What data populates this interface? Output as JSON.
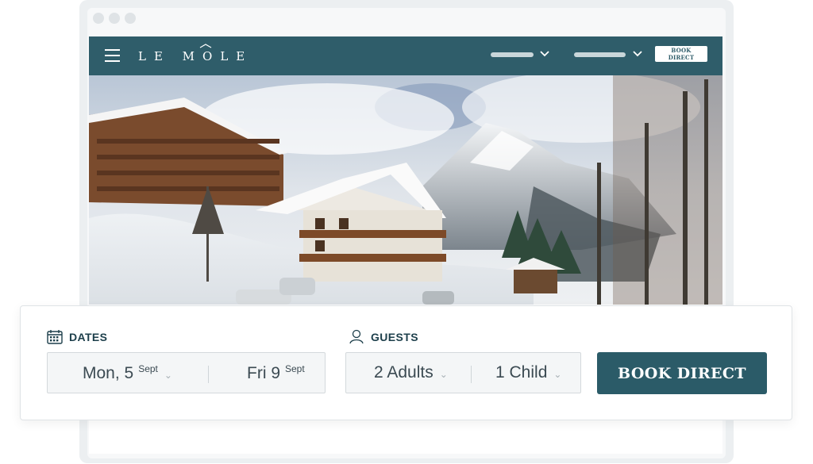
{
  "site": {
    "logo_text": "LE MOLE",
    "nav_items": [
      {
        "name": "nav-menu-1"
      },
      {
        "name": "nav-menu-2"
      }
    ],
    "header_button": "BOOK DIRECT"
  },
  "booking": {
    "dates": {
      "label": "DATES",
      "checkin_main": "Mon, 5",
      "checkin_sup": "Sept",
      "checkout_main": "Fri 9",
      "checkout_sup": "Sept"
    },
    "guests": {
      "label": "GUESTS",
      "adults": "2 Adults",
      "children": "1 Child"
    },
    "button": "BOOK DIRECT"
  },
  "icons": {
    "menu": "hamburger-icon",
    "calendar": "calendar-icon",
    "guest": "user-icon",
    "chevron": "chevron-down-icon"
  },
  "colors": {
    "brand": "#2f5d6a",
    "button": "#2b5b68",
    "label": "#1d3f4b"
  }
}
